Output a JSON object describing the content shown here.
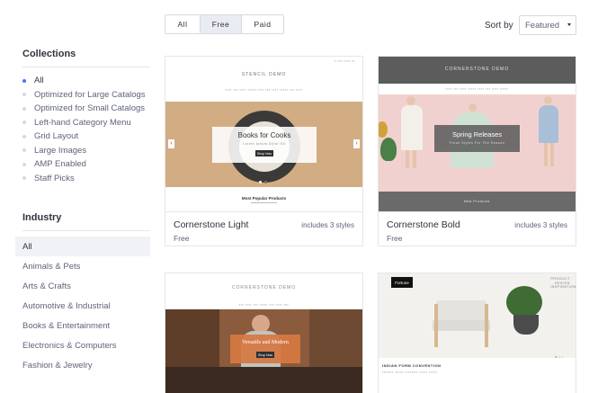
{
  "filters": {
    "all_label": "All",
    "free_label": "Free",
    "paid_label": "Paid",
    "selected": "Free"
  },
  "sort": {
    "label": "Sort by",
    "value": "Featured"
  },
  "sidebar": {
    "collections_title": "Collections",
    "collections": [
      {
        "label": "All",
        "active": true
      },
      {
        "label": "Optimized for Large Catalogs",
        "active": false
      },
      {
        "label": "Optimized for Small Catalogs",
        "active": false
      },
      {
        "label": "Left-hand Category Menu",
        "active": false
      },
      {
        "label": "Grid Layout",
        "active": false
      },
      {
        "label": "Large Images",
        "active": false
      },
      {
        "label": "AMP Enabled",
        "active": false
      },
      {
        "label": "Staff Picks",
        "active": false
      }
    ],
    "industry_title": "Industry",
    "industries": [
      {
        "label": "All",
        "active": true
      },
      {
        "label": "Animals & Pets",
        "active": false
      },
      {
        "label": "Arts & Crafts",
        "active": false
      },
      {
        "label": "Automotive & Industrial",
        "active": false
      },
      {
        "label": "Books & Entertainment",
        "active": false
      },
      {
        "label": "Electronics & Computers",
        "active": false
      },
      {
        "label": "Fashion & Jewelry",
        "active": false
      }
    ]
  },
  "themes": [
    {
      "name": "Cornerstone Light",
      "styles": "includes 3 styles",
      "price": "Free",
      "preview": {
        "logo": "STENCIL DEMO",
        "hero_title": "Books for Cooks",
        "hero_subtitle": "Lorem Ipsum Dolor Sit",
        "hero_button": "Shop Now",
        "section_title": "Most Popular Products"
      }
    },
    {
      "name": "Cornerstone Bold",
      "styles": "includes 3 styles",
      "price": "Free",
      "preview": {
        "logo": "CORNERSTONE DEMO",
        "hero_title": "Spring Releases",
        "hero_subtitle": "Fresh Styles For The Season",
        "footer_label": "New Products"
      }
    },
    {
      "preview": {
        "logo": "CORNERSTONE DEMO",
        "hero_title": "Versatile and Modern",
        "hero_button": "Shop Now"
      }
    },
    {
      "preview": {
        "logo": "Fortune",
        "side_text": "PRODUCT DESIGN INSPIRATION",
        "bottom_title": "INDIAN FORM CONVENTION"
      }
    }
  ],
  "colors": {
    "accent": "#4b71fc",
    "card_bold_header": "#5c5c5c",
    "card_light_hero": "#d2ad84",
    "card_bold_hero": "#f1d1cf",
    "card_bold_footer": "#6a6a6a"
  }
}
